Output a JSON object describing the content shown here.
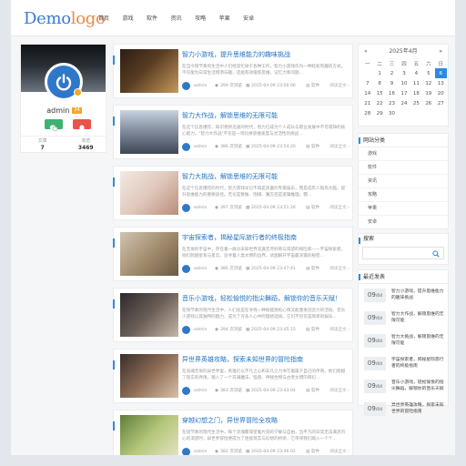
{
  "logo": {
    "part1": "Demo",
    "part2": "logo"
  },
  "nav": [
    "首页",
    "游戏",
    "软件",
    "资讯",
    "攻略",
    "苹果",
    "安卓"
  ],
  "profile": {
    "username": "admin",
    "level": "24",
    "stats": [
      {
        "label": "文章",
        "value": "7"
      },
      {
        "label": "浏览",
        "value": "3469"
      }
    ]
  },
  "posts": [
    {
      "title": "智力小游戏，提升思维能力的趣味挑战",
      "excerpt": "在当今快节奏的生活中人们经常忙碌于各种工作，智力小游戏作为一种轻松有趣的方式，不仅能为日常生活增添乐趣，还能有效锻炼思维，记忆力和问题...",
      "author": "admin",
      "views": "399 次浏览",
      "date": "2025-04-09 23:56:06",
      "category": "软件",
      "more": "阅读全文 ›"
    },
    {
      "title": "智力大作战，解锁思维的无限可能",
      "excerpt": "在这个信息爆炸、知识更新迅速的时代，智力已成为个人成长与职业发展中不可或缺的核心能力。\"智力大作战\"不仅是一场比拼思维速度与灵活性的挑战...",
      "author": "admin",
      "views": "386 次浏览",
      "date": "2025-04-09 23:54:20",
      "category": "软件",
      "more": "阅读全文 ›"
    },
    {
      "title": "智力大挑战，解锁思维的无限可能",
      "excerpt": "在这个信息爆炸的时代，智力游戏早已不再是孩童的专属娱乐，而是成年人锻炼大脑、提升思维能力的重要途径。无论是数独、围棋、魔方还是逻辑推理，都...",
      "author": "admin",
      "views": "397 次浏览",
      "date": "2025-04-09 23:51:26",
      "category": "软件",
      "more": "阅读全文 ›"
    },
    {
      "title": "宇宙探索者，揭秘星际旅行者的终极指南",
      "excerpt": "在无垠的宇宙中，存在着一群对未知世界充满无尽好奇与渴望的探险家——宇宙探索者。他们跨越星系与星云，追寻着人类文明的边界，试图解开宇宙最深邃的秘密...",
      "author": "admin",
      "views": "386 次浏览",
      "date": "2025-04-09 23:47:41",
      "category": "软件",
      "more": "阅读全文 ›"
    },
    {
      "title": "音乐小游戏，轻松愉悦的指尖舞蹈，解锁你的音乐天赋！",
      "excerpt": "在快节奏的现代生活中，人们总是在寻找一种既能放松心情又能激发创造力的活动。音乐小游戏以其独特的魅力，成为了许多人心中的理想选择。它们不仅仅是简单的娱乐...",
      "author": "admin",
      "views": "394 次浏览",
      "date": "2025-04-09 23:45:15",
      "category": "软件",
      "more": "阅读全文 ›"
    },
    {
      "title": "异世界英雄攻略，探索未知世界的冒险指南",
      "excerpt": "在浩瀚无垠的异世界里，英雄们以不凡之心和非凡之力书写着属于自己的传奇。他们跨越了现实的界限，踏入了一个充满魔法、怪兽、神秘生物与古老文明的奇幻...",
      "author": "admin",
      "views": "383 次浏览",
      "date": "2025-04-09 23:43:04",
      "category": "软件",
      "more": "阅读全文 ›"
    },
    {
      "title": "穿越幻想之门，异世界冒险全攻略",
      "excerpt": "在快节奏的现代生活中，每个灵魂都渴望着片刻的宁静与自由，当平凡的日常无法满足内心的渴望时，异世界冒险便成为了连接现实与幻想的桥梁，它带领我们踏入一个个...",
      "author": "admin",
      "views": "382 次浏览",
      "date": "2025-04-09 23:36:02",
      "category": "软件",
      "more": "阅读全文 ›"
    }
  ],
  "calendar": {
    "prev": "«",
    "title": "2025年4月",
    "next": "»",
    "dow": [
      "一",
      "二",
      "三",
      "四",
      "五",
      "六",
      "日"
    ],
    "weeks": [
      [
        "",
        "1",
        "2",
        "3",
        "4",
        "5",
        "6"
      ],
      [
        "7",
        "8",
        "9",
        "10",
        "11",
        "12",
        "13"
      ],
      [
        "14",
        "15",
        "16",
        "17",
        "18",
        "19",
        "20"
      ],
      [
        "21",
        "22",
        "23",
        "24",
        "25",
        "26",
        "27"
      ],
      [
        "28",
        "29",
        "30",
        "",
        "",
        "",
        ""
      ]
    ],
    "today": "6"
  },
  "categories": {
    "title": "网站分类",
    "items": [
      "游戏",
      "软件",
      "资讯",
      "攻略",
      "苹果",
      "安卓"
    ]
  },
  "search": {
    "title": "搜索",
    "placeholder": ""
  },
  "recent": {
    "title": "最近发表",
    "items": [
      {
        "day": "09",
        "month": "/04",
        "title": "智力小游戏，提升思维能力的趣味挑战"
      },
      {
        "day": "09",
        "month": "/04",
        "title": "智力大作战，解锁思维的无限可能"
      },
      {
        "day": "09",
        "month": "/04",
        "title": "智力大挑战，解锁思维的无限可能"
      },
      {
        "day": "09",
        "month": "/04",
        "title": "宇宙探索者，揭秘星际旅行者的终极指南"
      },
      {
        "day": "09",
        "month": "/04",
        "title": "音乐小游戏，轻松愉悦的指尖舞蹈，解锁你的音乐天赋"
      },
      {
        "day": "09",
        "month": "/04",
        "title": "异世界英雄攻略，探索未知世界的冒险指南"
      }
    ]
  },
  "colors": {
    "accent": "#2c8be0",
    "title_link": "#2273c0",
    "badge": "#f5a623",
    "green": "#3cb371",
    "red": "#e8534a"
  }
}
